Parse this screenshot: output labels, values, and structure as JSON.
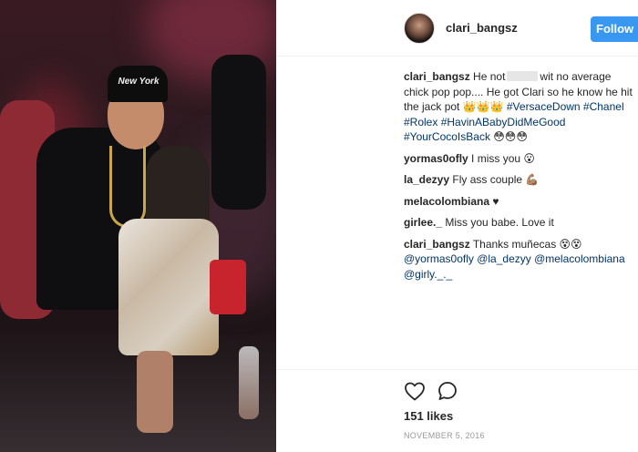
{
  "post": {
    "username": "clari_bangsz",
    "follow_label": "Follow",
    "photo_cap_text": "New York",
    "caption": {
      "user": "clari_bangsz",
      "text_before": "He not",
      "text_after": "wit no average chick pop pop.... He got Clari so he know he hit the jack pot 👑👑👑",
      "hashtags": "#VersaceDown #Chanel #Rolex #HavinABabyDidMeGood #YourCocoIsBack",
      "emojis": "😳😳😳"
    },
    "comments": [
      {
        "user": "yormas0ofly",
        "text": "I miss you 😮"
      },
      {
        "user": "la_dezyy",
        "text": "Fly ass couple 💪🏽"
      },
      {
        "user": "melacolombiana",
        "text": "♥"
      },
      {
        "user": "girlee._",
        "text": "Miss you babe. Love it"
      },
      {
        "user": "clari_bangsz",
        "text": "Thanks muñecas 😵😵",
        "mentions": "@yormas0ofly @la_dezyy @melacolombiana @girly._._"
      }
    ],
    "likes": "151 likes",
    "date": "NOVEMBER 5, 2016",
    "icons": {
      "like": "heart-icon",
      "comment": "comment-icon"
    },
    "colors": {
      "accent": "#3897f0",
      "link": "#003569"
    }
  }
}
